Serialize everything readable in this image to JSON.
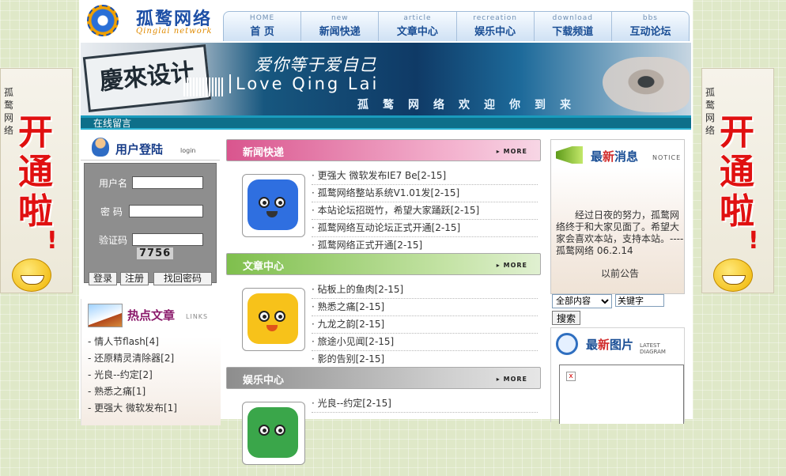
{
  "side_ads": {
    "small_text": "孤鹜网络",
    "big_text": "开通啦",
    "exclaim": "!"
  },
  "logo": {
    "title": "孤鹜网络",
    "subtitle": "Qinglai network"
  },
  "nav": [
    {
      "en": "HOME",
      "cn": "首 页"
    },
    {
      "en": "new",
      "cn": "新闻快递"
    },
    {
      "en": "article",
      "cn": "文章中心"
    },
    {
      "en": "recreation",
      "cn": "娱乐中心"
    },
    {
      "en": "download",
      "cn": "下载频道"
    },
    {
      "en": "bbs",
      "cn": "互动论坛"
    }
  ],
  "banner": {
    "stamp": "慶來设计",
    "slogan": "爱你等于爱自己",
    "love": "Love Qing Lai",
    "welcome": "孤鹜网络欢迎你到来"
  },
  "guestbook": "在线留言",
  "login": {
    "title": "用户登陆",
    "title_en": "login",
    "username_label": "用户名",
    "password_label": "密 码",
    "captcha_label": "验证码",
    "captcha_value": "7756",
    "login_btn": "登录",
    "register_btn": "注册",
    "forgot_btn": "找回密码"
  },
  "hot": {
    "title": "热点文章",
    "title_en": "LINKS",
    "items": [
      "- 情人节flash[4]",
      "- 还原精灵清除器[2]",
      "- 光良--约定[2]",
      "- 熟悉之痛[1]",
      "- 更强大 微软发布[1]"
    ]
  },
  "sections": {
    "news": {
      "title": "新闻快递",
      "more": "MORE",
      "items": [
        "· 更强大 微软发布IE7 Be[2-15]",
        "· 孤鹜网络整站系统V1.01发[2-15]",
        "· 本站论坛招斑竹，希望大家踊跃[2-15]",
        "· 孤鹜网络互动论坛正式开通[2-15]",
        "· 孤鹜网络正式开通[2-15]"
      ]
    },
    "article": {
      "title": "文章中心",
      "more": "MORE",
      "items": [
        "· 砧板上的鱼肉[2-15]",
        "· 熟悉之痛[2-15]",
        "· 九龙之韵[2-15]",
        "· 旅途小见闻[2-15]",
        "· 影的告别[2-15]"
      ]
    },
    "fun": {
      "title": "娱乐中心",
      "more": "MORE",
      "items": [
        "· 光良--约定[2-15]"
      ]
    }
  },
  "latest_news": {
    "title_a": "最",
    "title_b": "新",
    "title_c": "消息",
    "title_en": "NOTICE",
    "text": "经过日夜的努力，孤鹜网络终于和大家见面了。希望大家会喜欢本站，支持本站。----孤鹜网络 06.2.14",
    "more": "以前公告"
  },
  "search": {
    "select_value": "全部内容",
    "keyword": "关键字",
    "button": "搜索"
  },
  "latest_pics": {
    "title_a": "最",
    "title_b": "新",
    "title_c": "图片",
    "title_en": "LATEST DIAGRAM",
    "broken": "x"
  },
  "colors": {
    "news_head": "#d9558e",
    "article_head": "#7fbf4d",
    "fun_head": "#8d8d8d"
  }
}
